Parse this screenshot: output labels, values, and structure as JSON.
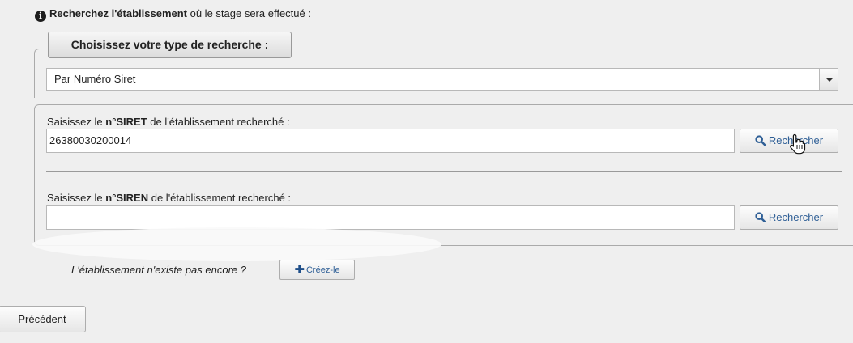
{
  "intro": {
    "bold": "Recherchez l'établissement",
    "rest": " où le stage sera effectué :"
  },
  "search_type": {
    "legend": "Choisissez votre type de recherche :",
    "selected": "Par Numéro Siret"
  },
  "siret": {
    "label_prefix": "Saisissez le ",
    "label_bold": "n°SIRET",
    "label_suffix": " de l'établissement recherché :",
    "value": "26380030200014",
    "button": "Rechercher"
  },
  "siren": {
    "label_prefix": "Saisissez le ",
    "label_bold": "n°SIREN",
    "label_suffix": " de l'établissement recherché :",
    "value": "",
    "button": "Rechercher"
  },
  "create": {
    "question": "L'établissement n'existe pas encore ?",
    "button": "Créez-le"
  },
  "nav": {
    "previous": "Précédent"
  },
  "icons": {
    "info": "info-icon",
    "search": "search-icon",
    "plus": "plus-icon",
    "cursor": "hand-pointer-cursor"
  },
  "colors": {
    "button_text": "#2f5f96",
    "background": "#efefef"
  }
}
